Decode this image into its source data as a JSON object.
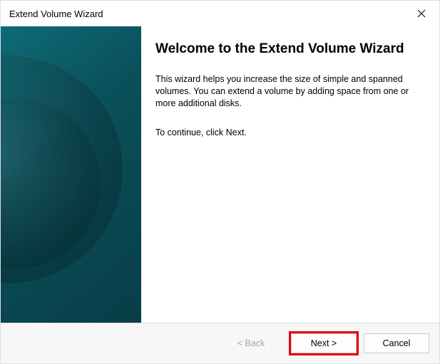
{
  "titlebar": {
    "title": "Extend Volume Wizard"
  },
  "main": {
    "heading": "Welcome to the Extend Volume Wizard",
    "description": "This wizard helps you increase the size of simple and spanned volumes. You can extend a volume  by adding space from one or more additional disks.",
    "continue_hint": "To continue, click Next."
  },
  "footer": {
    "back_label": "< Back",
    "next_label": "Next >",
    "cancel_label": "Cancel"
  }
}
